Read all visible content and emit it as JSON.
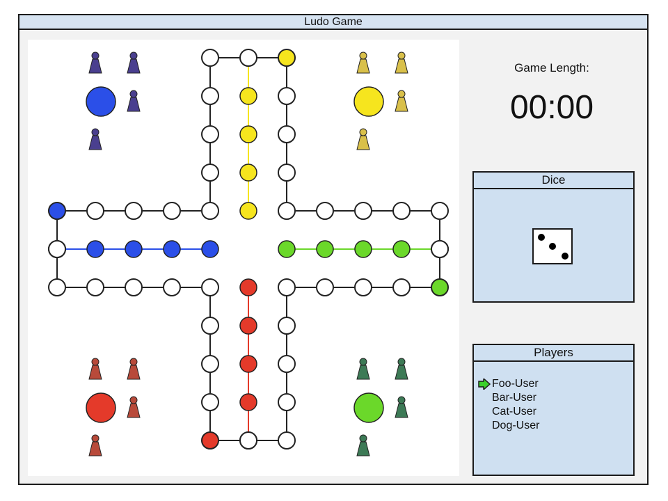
{
  "window": {
    "title": "Ludo Game"
  },
  "game_length": {
    "label": "Game Length:",
    "time": "00:00"
  },
  "dice": {
    "title": "Dice",
    "value": 3
  },
  "players": {
    "title": "Players",
    "active_index": 0,
    "list": [
      "Foo-User",
      "Bar-User",
      "Cat-User",
      "Dog-User"
    ]
  },
  "colors": {
    "blue": "#2b4fe8",
    "yellow": "#f6e51e",
    "red": "#e43a2a",
    "green": "#6bd82a",
    "pawn_blue": "#4a3f8f",
    "pawn_yellow": "#d9c04a",
    "pawn_red": "#b84a3a",
    "pawn_green": "#3d7a56",
    "empty": "#ffffff",
    "outline": "#222222",
    "turn_arrow": "#3ad12a"
  }
}
